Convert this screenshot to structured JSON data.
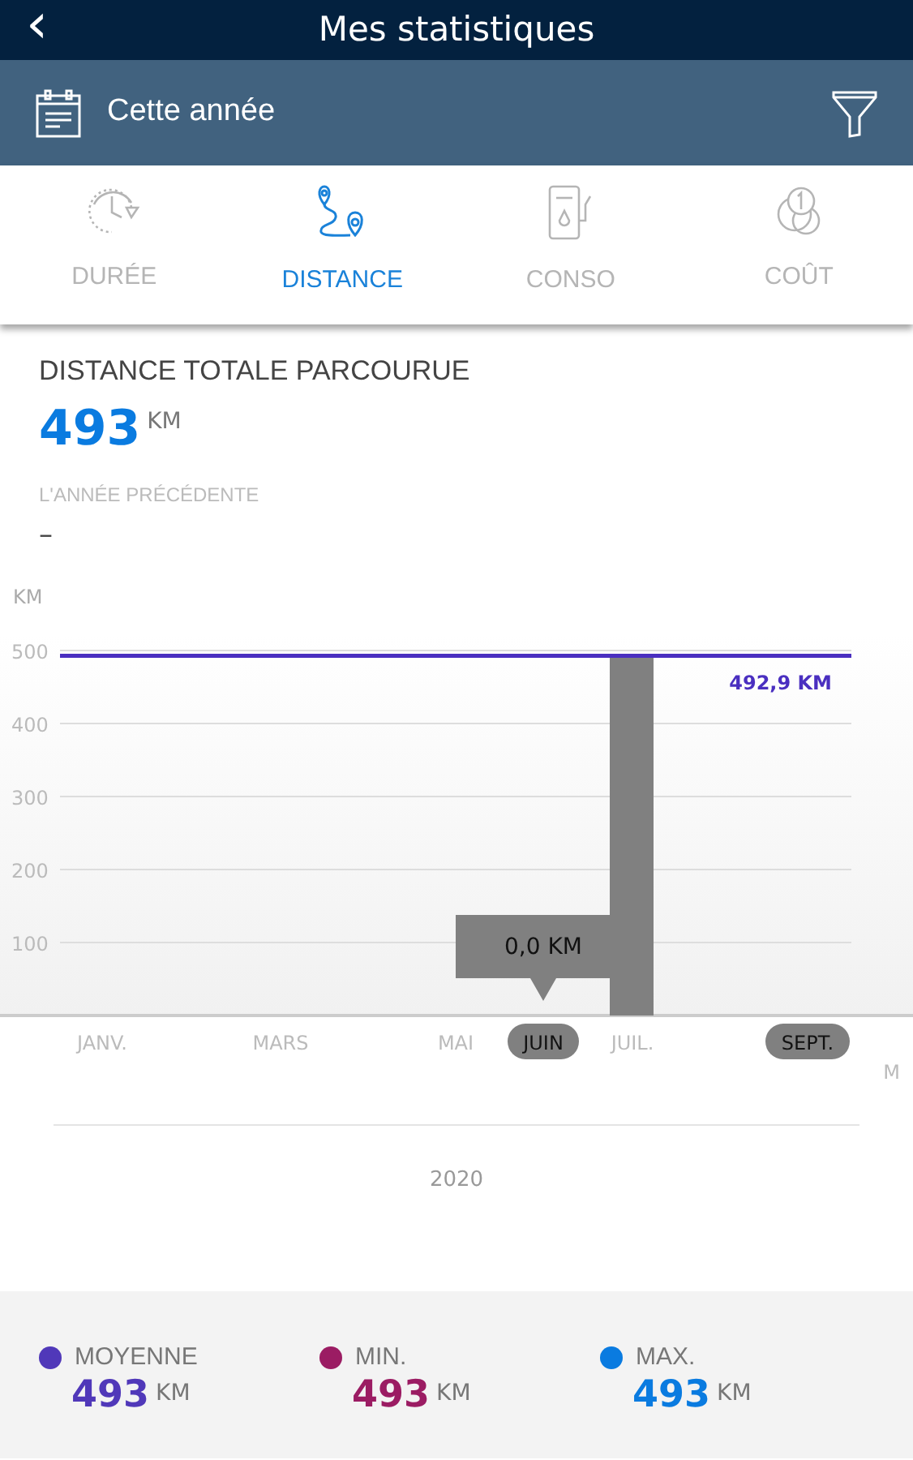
{
  "header": {
    "back": "‹",
    "title": "Mes statistiques"
  },
  "period": {
    "label": "Cette année"
  },
  "tabs": [
    {
      "label": "DURÉE",
      "kind": "clock",
      "selected": false
    },
    {
      "label": "DISTANCE",
      "kind": "route",
      "selected": true
    },
    {
      "label": "CONSO",
      "kind": "pump",
      "selected": false
    },
    {
      "label": "COÛT",
      "kind": "coins",
      "selected": false
    }
  ],
  "summary": {
    "title": "DISTANCE TOTALE PARCOURUE",
    "value": "493",
    "unit": "KM",
    "previous_label": "L'ANNÉE PRÉCÉDENTE",
    "previous_value": "–"
  },
  "chart": {
    "chart_data": {
      "type": "bar",
      "ylabel": "KM",
      "categories": [
        "JANV.",
        "MARS",
        "MAI",
        "JUIN",
        "JUIL.",
        "SEPT."
      ],
      "values": [
        null,
        null,
        null,
        0,
        490,
        null
      ],
      "ylim": [
        0,
        500
      ],
      "yticks": [
        100,
        200,
        300,
        400,
        500
      ],
      "grid": true,
      "ref_lines": [
        {
          "axis": "y",
          "value": 492.9,
          "label": "492,9 KM",
          "color": "#4a2fc0"
        }
      ]
    },
    "months": [
      {
        "highlighted": false
      },
      {
        "highlighted": false
      },
      {
        "highlighted": false
      },
      {
        "highlighted": true,
        "tooltip": "0,0 KM"
      },
      {
        "highlighted": false
      },
      {
        "highlighted": true
      }
    ],
    "edge_label": "M",
    "year": "2020"
  },
  "stats": [
    {
      "label": "MOYENNE",
      "value": "493",
      "unit": "KM",
      "color": "#5038b9"
    },
    {
      "label": "MIN.",
      "value": "493",
      "unit": "KM",
      "color": "#9b1c63"
    },
    {
      "label": "MAX.",
      "value": "493",
      "unit": "KM",
      "color": "#0a7be0"
    }
  ]
}
